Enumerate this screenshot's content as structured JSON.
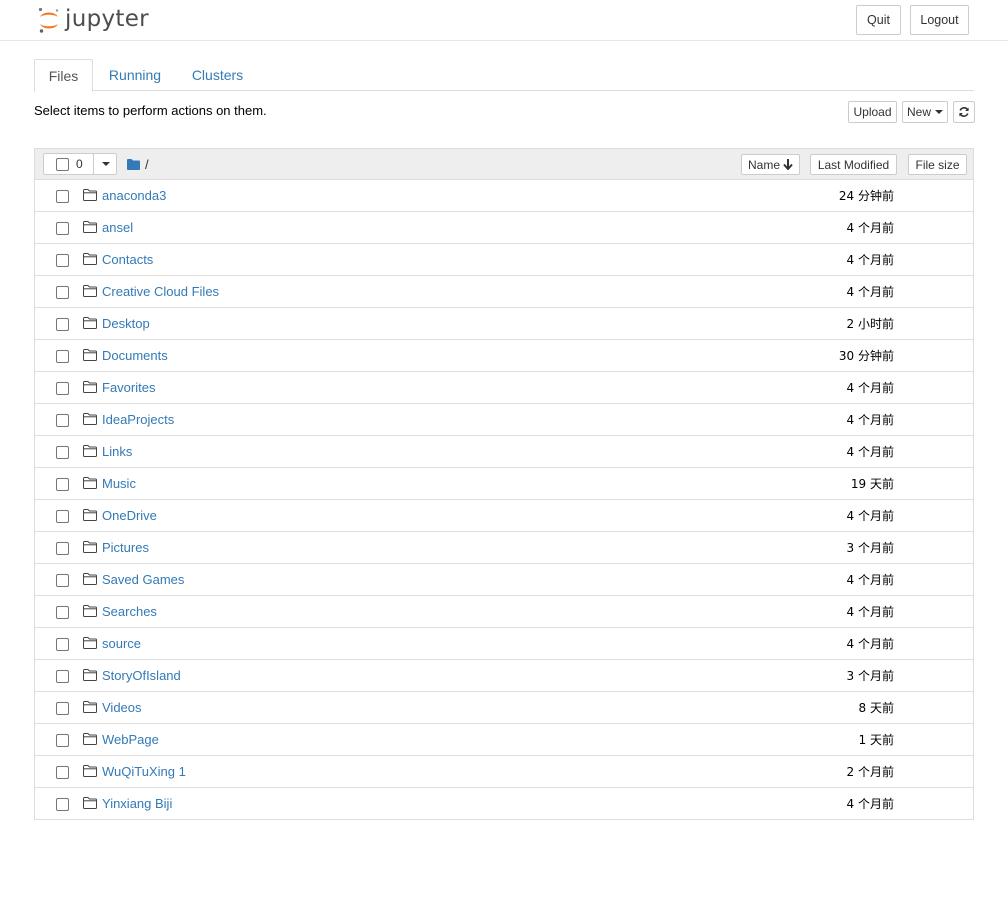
{
  "header": {
    "logo_text": "jupyter",
    "quit_label": "Quit",
    "logout_label": "Logout"
  },
  "tabs": [
    {
      "label": "Files",
      "active": true
    },
    {
      "label": "Running",
      "active": false
    },
    {
      "label": "Clusters",
      "active": false
    }
  ],
  "toolbar": {
    "hint": "Select items to perform actions on them.",
    "upload_label": "Upload",
    "new_label": "New",
    "refresh_icon": "refresh-icon"
  },
  "list_header": {
    "selected_count": "0",
    "breadcrumb_root": "/",
    "sort_name_label": "Name",
    "sort_modified_label": "Last Modified",
    "sort_size_label": "File size"
  },
  "items": [
    {
      "name": "anaconda3",
      "modified": "24 分钟前"
    },
    {
      "name": "ansel",
      "modified": "4 个月前"
    },
    {
      "name": "Contacts",
      "modified": "4 个月前"
    },
    {
      "name": "Creative Cloud Files",
      "modified": "4 个月前"
    },
    {
      "name": "Desktop",
      "modified": "2 小时前"
    },
    {
      "name": "Documents",
      "modified": "30 分钟前"
    },
    {
      "name": "Favorites",
      "modified": "4 个月前"
    },
    {
      "name": "IdeaProjects",
      "modified": "4 个月前"
    },
    {
      "name": "Links",
      "modified": "4 个月前"
    },
    {
      "name": "Music",
      "modified": "19 天前"
    },
    {
      "name": "OneDrive",
      "modified": "4 个月前"
    },
    {
      "name": "Pictures",
      "modified": "3 个月前"
    },
    {
      "name": "Saved Games",
      "modified": "4 个月前"
    },
    {
      "name": "Searches",
      "modified": "4 个月前"
    },
    {
      "name": "source",
      "modified": "4 个月前"
    },
    {
      "name": "StoryOfIsland",
      "modified": "3 个月前"
    },
    {
      "name": "Videos",
      "modified": "8 天前"
    },
    {
      "name": "WebPage",
      "modified": "1 天前"
    },
    {
      "name": "WuQiTuXing 1",
      "modified": "2 个月前"
    },
    {
      "name": "Yinxiang Biji",
      "modified": "4 个月前"
    }
  ],
  "colors": {
    "link": "#337ab7",
    "logo_orange": "#f37726",
    "header_bg": "#eeeeee"
  }
}
